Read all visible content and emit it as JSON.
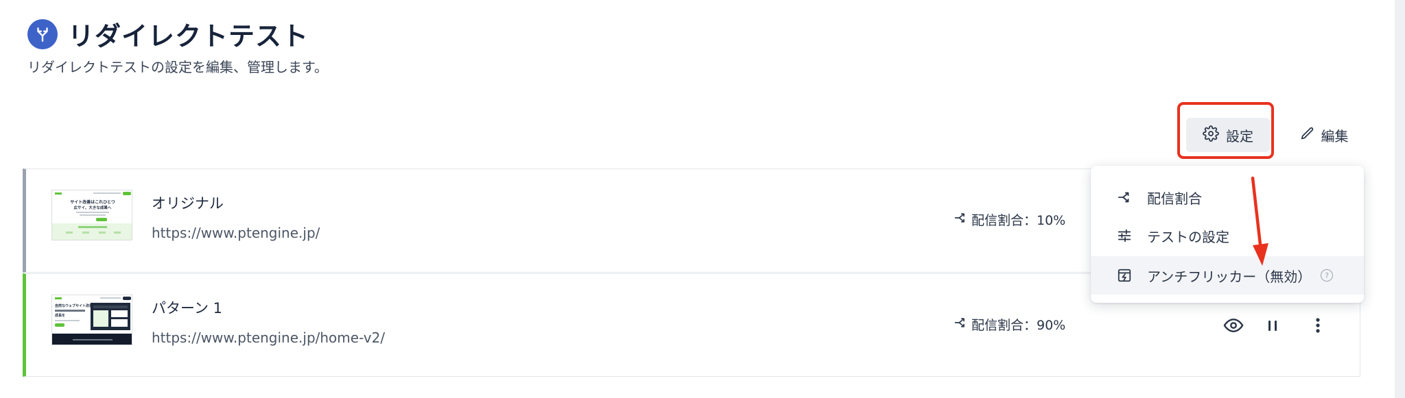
{
  "header": {
    "title": "リダイレクトテスト",
    "subtitle": "リダイレクトテストの設定を編集、管理します。",
    "icon": "split-arrows-icon",
    "accent_color": "#3d63c9"
  },
  "toolbar": {
    "settings_label": "設定",
    "edit_label": "編集"
  },
  "variants": [
    {
      "name": "オリジナル",
      "url": "https://www.ptengine.jp/",
      "split_label": "配信割合：10%",
      "indicator_color": "#9aa2ae"
    },
    {
      "name": "パターン 1",
      "url": "https://www.ptengine.jp/home-v2/",
      "split_label": "配信割合：90%",
      "indicator_color": "#5fc33a"
    }
  ],
  "thumbnails": {
    "original_headline": "サイト改善はこれひとつ",
    "original_sub": "広サイ、大きな成果へ",
    "pattern_headline": "自然なウェブサイト改善で",
    "pattern_sub": "成長を"
  },
  "dropdown_menu": {
    "items": [
      {
        "label": "配信割合",
        "icon": "split-icon"
      },
      {
        "label": "テストの設定",
        "icon": "sliders-icon"
      },
      {
        "label": "アンチフリッカー（無効）",
        "icon": "anti-flicker-icon",
        "help": "?"
      }
    ]
  },
  "annotation": {
    "highlight_color": "#e8321e"
  }
}
